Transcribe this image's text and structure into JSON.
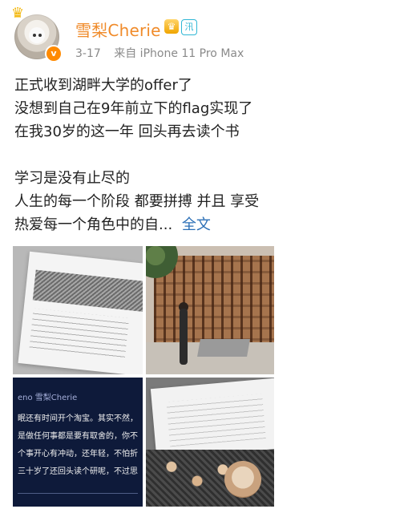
{
  "post": {
    "user": {
      "name": "雪梨Cherie",
      "vip_icon": "crown-icon",
      "badge_icon": "shield-badge-icon"
    },
    "meta": {
      "date": "3-17",
      "source": "来自 iPhone 11 Pro Max"
    },
    "text_lines": [
      "正式收到湖畔大学的offer了",
      "没想到自己在9年前立下的flag实现了",
      "在我30岁的这一年 回头再去读个书",
      "",
      "学习是没有止尽的",
      "人生的每一个阶段 都要拼搏 并且 享受",
      "热爱每一个角色中的自..."
    ],
    "more_link": "全文",
    "images": {
      "screenshot_text": [
        "eno 雪梨Cherie",
        "眠还有时间开个淘宝。其实不然，",
        "是做任何事都是要有取舍的，你不",
        "个事开心有冲动，还年轻，不怕折",
        "三十岁了还回头读个研呢，不过思"
      ]
    }
  }
}
